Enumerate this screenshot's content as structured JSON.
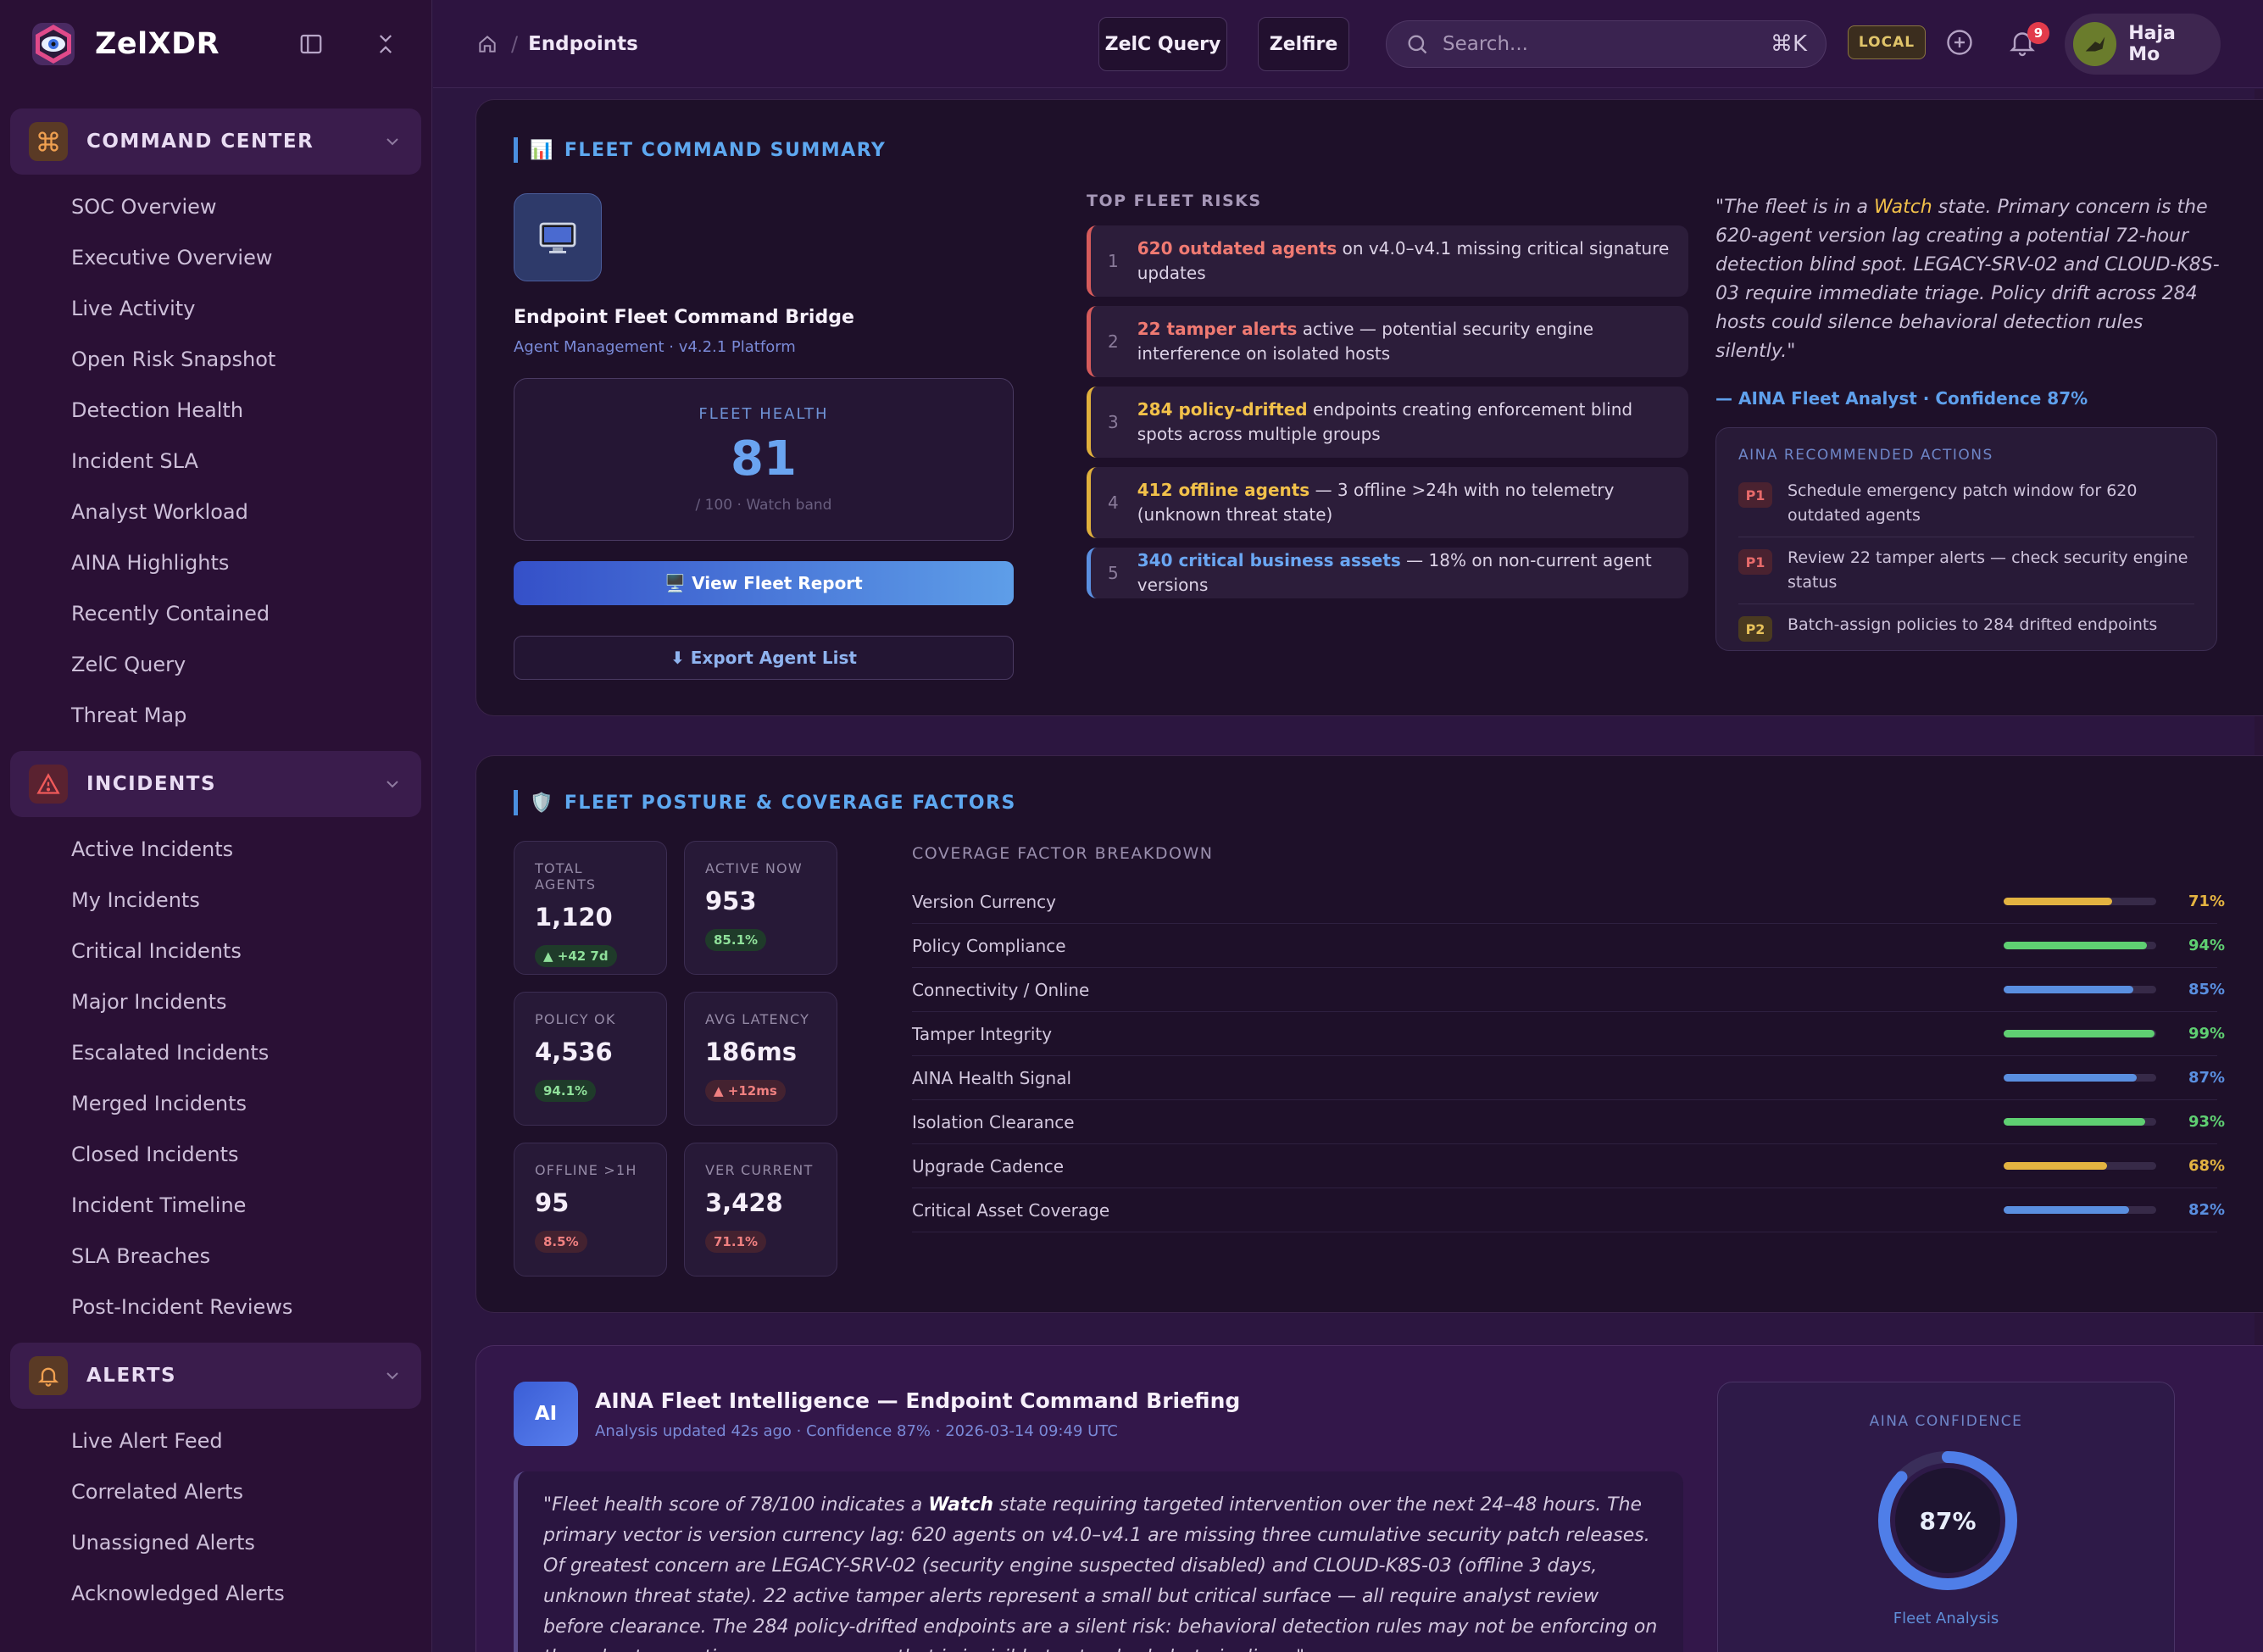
{
  "app": {
    "name": "ZelXDR"
  },
  "sidebar": {
    "sections": [
      {
        "label": "COMMAND CENTER",
        "icon": "command-icon",
        "items": [
          "SOC Overview",
          "Executive Overview",
          "Live Activity",
          "Open Risk Snapshot",
          "Detection Health",
          "Incident SLA",
          "Analyst Workload",
          "AINA Highlights",
          "Recently Contained",
          "ZelC Query",
          "Threat Map"
        ]
      },
      {
        "label": "INCIDENTS",
        "icon": "warning-icon",
        "items": [
          "Active Incidents",
          "My Incidents",
          "Critical Incidents",
          "Major Incidents",
          "Escalated Incidents",
          "Merged Incidents",
          "Closed Incidents",
          "Incident Timeline",
          "SLA Breaches",
          "Post-Incident Reviews"
        ]
      },
      {
        "label": "ALERTS",
        "icon": "bell-icon",
        "items": [
          "Live Alert Feed",
          "Correlated Alerts",
          "Unassigned Alerts",
          "Acknowledged Alerts"
        ]
      }
    ]
  },
  "topbar": {
    "breadcrumb": "Endpoints",
    "zelc_query": "ZelC Query",
    "zelfire": "Zelfire",
    "search_placeholder": "Search...",
    "shortcut": "⌘K",
    "env_badge": "LOCAL",
    "notification_count": "9",
    "user_name": "Haja Mo"
  },
  "summary": {
    "title": "FLEET COMMAND SUMMARY",
    "title_emoji": "📊",
    "monitor_emoji": "🖥️",
    "bridge_title": "Endpoint Fleet Command Bridge",
    "bridge_sub": "Agent Management · v4.2.1 Platform",
    "health_label": "FLEET HEALTH",
    "health_value": "81",
    "health_sub": "/ 100 · Watch band",
    "view_report": "🖥️ View Fleet Report",
    "export": "⬇ Export Agent List",
    "risks_head": "TOP FLEET RISKS",
    "risks": [
      {
        "num": "1",
        "hl": "620 outdated agents",
        "rest": " on v4.0–v4.1 missing critical signature updates",
        "tone": "red"
      },
      {
        "num": "2",
        "hl": "22 tamper alerts",
        "rest": " active — potential security engine interference on isolated hosts",
        "tone": "red"
      },
      {
        "num": "3",
        "hl": "284 policy-drifted",
        "rest": " endpoints creating enforcement blind spots across multiple groups",
        "tone": "amber"
      },
      {
        "num": "4",
        "hl": "412 offline agents",
        "rest": " — 3 offline >24h with no telemetry (unknown threat state)",
        "tone": "amber"
      },
      {
        "num": "5",
        "hl": "340 critical business assets",
        "rest": " — 18% on non-current agent versions",
        "tone": "blue"
      }
    ],
    "quote_pre": "\"The fleet is in a ",
    "quote_watch": "Watch",
    "quote_post": " state. Primary concern is the 620-agent version lag creating a potential 72-hour detection blind spot. LEGACY-SRV-02 and CLOUD-K8S-03 require immediate triage. Policy drift across 284 hosts could silence behavioral detection rules silently.\"",
    "quote_by": "— AINA Fleet Analyst · Confidence 87%",
    "actions_head": "AINA RECOMMENDED ACTIONS",
    "actions": [
      {
        "prio": "P1",
        "text": "Schedule emergency patch window for 620 outdated agents"
      },
      {
        "prio": "P1",
        "text": "Review 22 tamper alerts — check security engine status"
      },
      {
        "prio": "P2",
        "text": "Batch-assign policies to 284 drifted endpoints"
      }
    ]
  },
  "posture": {
    "title": "FLEET POSTURE & COVERAGE FACTORS",
    "title_emoji": "🛡️",
    "tiles": [
      {
        "label": "TOTAL AGENTS",
        "value": "1,120",
        "badge": "▲ +42 7d",
        "tone": "green"
      },
      {
        "label": "ACTIVE NOW",
        "value": "953",
        "badge": "85.1%",
        "tone": "green"
      },
      {
        "label": "POLICY OK",
        "value": "4,536",
        "badge": "94.1%",
        "tone": "green"
      },
      {
        "label": "AVG LATENCY",
        "value": "186ms",
        "badge": "▲ +12ms",
        "tone": "red"
      },
      {
        "label": "OFFLINE >1H",
        "value": "95",
        "badge": "8.5%",
        "tone": "red"
      },
      {
        "label": "VER CURRENT",
        "value": "3,428",
        "badge": "71.1%",
        "tone": "red"
      }
    ],
    "factors_head": "COVERAGE FACTOR BREAKDOWN",
    "factors": [
      {
        "name": "Version Currency",
        "value": 71,
        "pct": "71%",
        "color": "#e3b341"
      },
      {
        "name": "Policy Compliance",
        "value": 94,
        "pct": "94%",
        "color": "#5fcf72"
      },
      {
        "name": "Connectivity / Online",
        "value": 85,
        "pct": "85%",
        "color": "#5a8fe0"
      },
      {
        "name": "Tamper Integrity",
        "value": 99,
        "pct": "99%",
        "color": "#5fcf72"
      },
      {
        "name": "AINA Health Signal",
        "value": 87,
        "pct": "87%",
        "color": "#5a8fe0"
      },
      {
        "name": "Isolation Clearance",
        "value": 93,
        "pct": "93%",
        "color": "#5fcf72"
      },
      {
        "name": "Upgrade Cadence",
        "value": 68,
        "pct": "68%",
        "color": "#e3b341"
      },
      {
        "name": "Critical Asset Coverage",
        "value": 82,
        "pct": "82%",
        "color": "#5a8fe0"
      }
    ]
  },
  "aina": {
    "badge": "AI",
    "title": "AINA Fleet Intelligence — Endpoint Command Briefing",
    "sub": "Analysis updated 42s ago · Confidence 87% · 2026-03-14 09:49 UTC",
    "quote_pre": "\"Fleet health score of 78/100 indicates a ",
    "quote_bold": "Watch",
    "quote_post": " state requiring targeted intervention over the next 24–48 hours. The primary vector is version currency lag: 620 agents on v4.0–v4.1 are missing three cumulative security patch releases. Of greatest concern are LEGACY-SRV-02 (security engine suspected disabled) and CLOUD-K8S-03 (offline 3 days, unknown threat state). 22 active tamper alerts represent a small but critical surface — all require analyst review before clearance. The 284 policy-drifted endpoints are a silent risk: behavioral detection rules may not be enforcing on these hosts, creating a coverage gap that is invisible to standard alert pipelines.\"",
    "conf_label": "AINA CONFIDENCE",
    "conf_value": "87%",
    "conf_fraction": 0.87,
    "conf_foot": "Fleet Analysis"
  },
  "colors": {
    "accent": "#5ea8f0",
    "red": "#f07a72",
    "amber": "#f2c14a",
    "green": "#5fcf72"
  }
}
